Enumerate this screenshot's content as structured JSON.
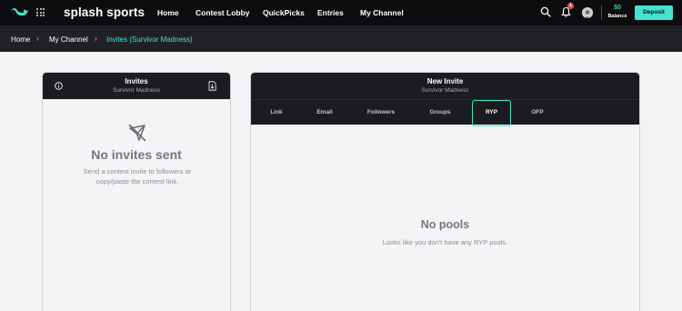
{
  "brand": {
    "name": "splash sports"
  },
  "nav": {
    "links": [
      "Home",
      "Contest Lobby",
      "QuickPicks",
      "Entries",
      "My Channel"
    ],
    "notification_count": "1",
    "balance_amount": "$0",
    "balance_label": "Balance",
    "deposit_label": "Deposit"
  },
  "breadcrumb": [
    "Home",
    "My Channel",
    "Invites (Survivor Madness)"
  ],
  "invites_panel": {
    "title": "Invites",
    "subtitle": "Survivor Madness",
    "empty_title": "No invites sent",
    "empty_text": "Send a contest invite to followers or copy/paste the contest link."
  },
  "new_invite_panel": {
    "title": "New Invite",
    "subtitle": "Survivor Madness",
    "tabs": [
      "Link",
      "Email",
      "Followers",
      "Groups",
      "RYP",
      "OFP"
    ],
    "active_tab": "RYP",
    "empty_title": "No pools",
    "empty_text": "Looks like you don't have any RYP pools."
  },
  "colors": {
    "accent": "#45e3d2",
    "balance": "#3ed17f",
    "nav_bg": "#0c0d0f",
    "panel_header_bg": "#1b1c1f"
  },
  "icons": [
    "whale-logo-icon",
    "grid-menu-icon",
    "search-icon",
    "bell-icon",
    "info-icon",
    "download-icon",
    "paper-plane-off-icon"
  ]
}
